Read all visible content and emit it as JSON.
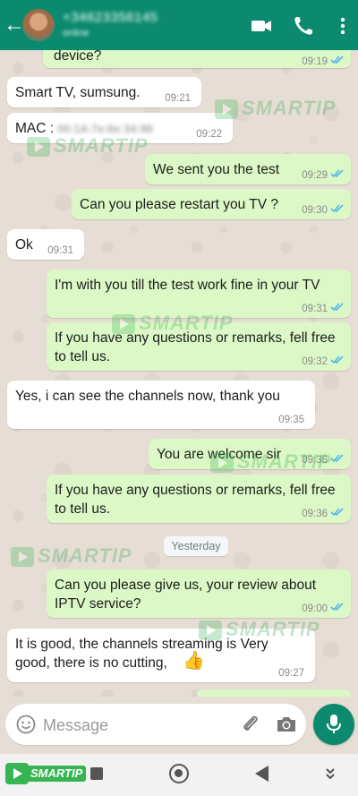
{
  "header": {
    "back_icon": "arrow-left-icon",
    "contact_name": "+34623356145",
    "contact_status": "online",
    "video_icon": "video-camera-icon",
    "phone_icon": "phone-icon",
    "menu_icon": "more-vertical-icon"
  },
  "messages": [
    {
      "dir": "out",
      "text": "device?",
      "time": "09:19",
      "ticks": "read"
    },
    {
      "dir": "in",
      "text": "Smart TV, sumsung.",
      "time": "09:21"
    },
    {
      "dir": "in",
      "label": "MAC : ",
      "redacted": "00:1A:7e:6e:34:98",
      "time": "09:22"
    },
    {
      "dir": "out",
      "text": "We sent you the test",
      "time": "09:29",
      "ticks": "read"
    },
    {
      "dir": "out",
      "text": "Can you please restart you TV ?",
      "time": "09:30",
      "ticks": "read"
    },
    {
      "dir": "in",
      "text": "Ok",
      "time": "09:31"
    },
    {
      "dir": "out",
      "text": "I'm with you till the test work fine in your TV",
      "time": "09:31",
      "ticks": "read"
    },
    {
      "dir": "out",
      "text": "If you have any questions or remarks, fell free to tell us.",
      "time": "09:32",
      "ticks": "read"
    },
    {
      "dir": "in",
      "text": "Yes, i can see the channels now, thank you",
      "time": "09:35"
    },
    {
      "dir": "out",
      "text": "You are welcome sir",
      "time": "09:36",
      "ticks": "read"
    },
    {
      "dir": "out",
      "text": "If you have any questions or remarks, fell free to tell us.",
      "time": "09:36",
      "ticks": "read"
    },
    {
      "dir": "out",
      "text": "Can you please give us, your review about IPTV service?",
      "time": "09:00",
      "ticks": "read"
    },
    {
      "dir": "in",
      "text": "It is good, the channels streaming is Very good, there is no cutting,",
      "emoji": "👍",
      "time": "09:27"
    }
  ],
  "date_divider": "Yesterday",
  "watermark_text": "SMARTIP",
  "composer": {
    "placeholder": "Message",
    "emoji_icon": "emoji-icon",
    "attach_icon": "paperclip-icon",
    "camera_icon": "camera-icon",
    "mic_icon": "microphone-icon"
  },
  "navbar": {
    "logo_text": "SMARTIP"
  },
  "colors": {
    "header": "#0b8a6f",
    "outgoing_bubble": "#dcf8c6",
    "incoming_bubble": "#ffffff",
    "tick_read": "#4fb6ec",
    "watermark": "#27a84a"
  }
}
